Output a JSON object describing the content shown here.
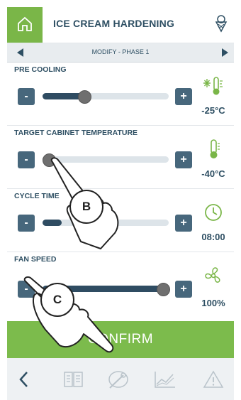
{
  "header": {
    "title": "ICE CREAM HARDENING"
  },
  "subbar": {
    "phase_label": "MODIFY - PHASE 1"
  },
  "params": [
    {
      "label": "PRE COOLING",
      "value": "-25°C",
      "level": 0.33
    },
    {
      "label": "TARGET CABINET TEMPERATURE",
      "value": "-40°C",
      "level": 0.05
    },
    {
      "label": "CYCLE TIME",
      "value": "08:00",
      "level": 0.15
    },
    {
      "label": "FAN SPEED",
      "value": "100%",
      "level": 1.0
    }
  ],
  "buttons": {
    "minus_label": "-",
    "plus_label": "+",
    "confirm_label": "CONFIRM"
  },
  "callouts": {
    "b": "B",
    "c": "C"
  },
  "colors": {
    "accent_green": "#7ab648",
    "dark_blue": "#2e4f63",
    "button_blue": "#47677c"
  },
  "icons": [
    "home-icon",
    "ice-cream-cone-icon",
    "thermometer-snowflake-icon",
    "thermometer-icon",
    "clock-icon",
    "fan-icon",
    "back-icon",
    "recipe-book-icon",
    "probe-icon",
    "chart-icon",
    "warning-icon"
  ]
}
